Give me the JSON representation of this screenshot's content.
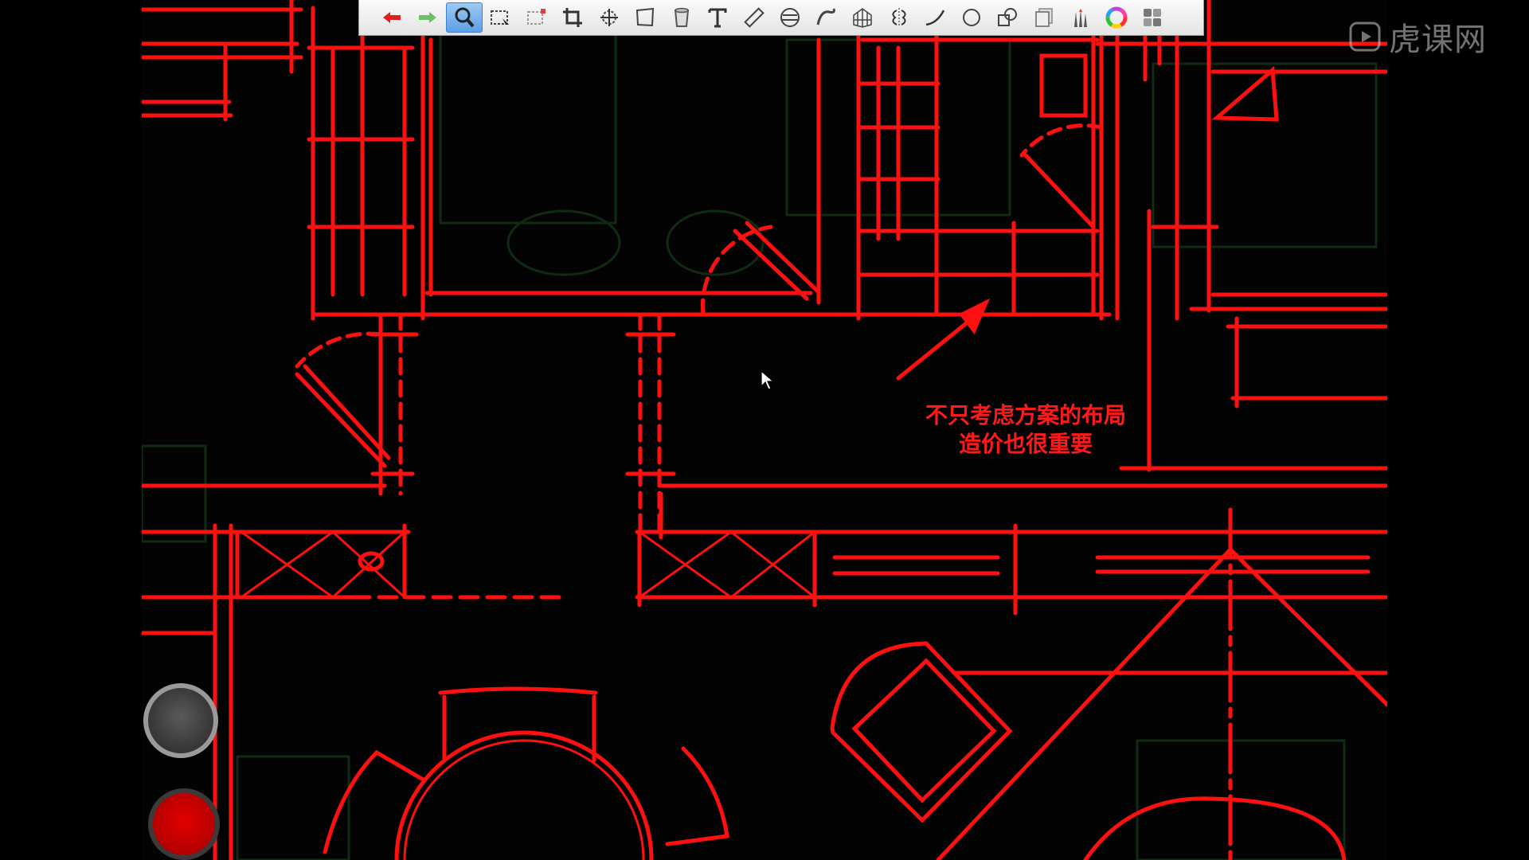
{
  "toolbar": {
    "tools": [
      {
        "icon": "undo-icon",
        "color": "#e02020"
      },
      {
        "icon": "redo-icon",
        "color": "#6cc06c"
      },
      {
        "icon": "magnify-icon",
        "active": true
      },
      {
        "icon": "rect-select-icon"
      },
      {
        "icon": "fill-select-icon"
      },
      {
        "icon": "crop-icon"
      },
      {
        "icon": "transform-icon"
      },
      {
        "icon": "distort-icon"
      },
      {
        "icon": "bucket-icon"
      },
      {
        "icon": "text-icon",
        "glyph": "T"
      },
      {
        "icon": "ruler-icon"
      },
      {
        "icon": "ellipse-guide-icon"
      },
      {
        "icon": "french-curve-icon"
      },
      {
        "icon": "perspective-grid-icon"
      },
      {
        "icon": "symmetry-icon"
      },
      {
        "icon": "curve-icon"
      },
      {
        "icon": "circle-icon"
      },
      {
        "icon": "shapes-icon"
      },
      {
        "icon": "layers-icon"
      },
      {
        "icon": "brushes-icon"
      },
      {
        "icon": "color-wheel-icon"
      },
      {
        "icon": "menu-grid-icon"
      }
    ]
  },
  "annotation": {
    "line1": "不只考虑方案的布局",
    "line2": "造价也很重要",
    "color": "#ff1a1a"
  },
  "watermark": {
    "text": "虎课网"
  },
  "colors": {
    "drawing": "#ff1010",
    "background": "#000000",
    "underlay": "#0f2a0f"
  }
}
